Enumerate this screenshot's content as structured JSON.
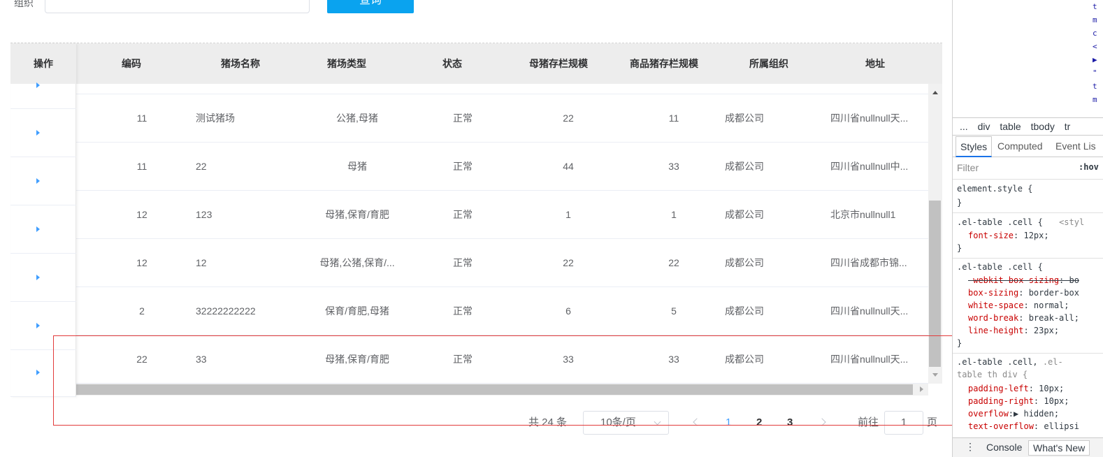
{
  "filter": {
    "label": "组织",
    "input_value": "",
    "query_label": "查询"
  },
  "table": {
    "headers": [
      "操作",
      "编码",
      "猪场名称",
      "猪场类型",
      "状态",
      "母猪存栏规模",
      "商品猪存栏规模",
      "所属组织",
      "地址"
    ],
    "rows": [
      {
        "code": "11",
        "name": "测试猪场",
        "type": "公猪,母猪",
        "status": "正常",
        "sow": "22",
        "commercial": "11",
        "org": "成都公司",
        "address": "四川省nullnull天..."
      },
      {
        "code": "11",
        "name": "22",
        "type": "母猪",
        "status": "正常",
        "sow": "44",
        "commercial": "33",
        "org": "成都公司",
        "address": "四川省nullnull中..."
      },
      {
        "code": "12",
        "name": "123",
        "type": "母猪,保育/育肥",
        "status": "正常",
        "sow": "1",
        "commercial": "1",
        "org": "成都公司",
        "address": "北京市nullnull1"
      },
      {
        "code": "12",
        "name": "12",
        "type": "母猪,公猪,保育/...",
        "status": "正常",
        "sow": "22",
        "commercial": "22",
        "org": "成都公司",
        "address": "四川省成都市锦..."
      },
      {
        "code": "2",
        "name": "32222222222",
        "type": "保育/育肥,母猪",
        "status": "正常",
        "sow": "6",
        "commercial": "5",
        "org": "成都公司",
        "address": "四川省nullnull天..."
      },
      {
        "code": "22",
        "name": "33",
        "type": "母猪,保育/育肥",
        "status": "正常",
        "sow": "33",
        "commercial": "33",
        "org": "成都公司",
        "address": "四川省nullnull天..."
      }
    ]
  },
  "pagination": {
    "total": "共 24 条",
    "page_size": "10条/页",
    "pages": [
      "1",
      "2",
      "3"
    ],
    "current": "1",
    "goto_label": "前往",
    "goto_value": "1",
    "goto_unit": "页"
  },
  "devtools": {
    "breadcrumb": [
      "...",
      "div",
      "table",
      "tbody",
      "tr"
    ],
    "tabs": [
      "Styles",
      "Computed",
      "Event Lis"
    ],
    "filter_placeholder": "Filter",
    "hov": ":hov",
    "drawer_tabs": [
      "Console",
      "What's New"
    ],
    "dom_chars": [
      "t",
      "m",
      "c",
      "<",
      "▶",
      "\"",
      "t",
      "m"
    ],
    "rules": {
      "r0_sel": "element.style {",
      "r0_close": "}",
      "r1_sel": ".el-table .cell {",
      "r1_src": "<styl",
      "r1_p1": "font-size",
      "r1_v1": ": 12px;",
      "r1_close": "}",
      "r2_sel": ".el-table .cell {",
      "r2_p1": "-webkit-box-sizing",
      "r2_v1": ": bo",
      "r2_p2": "box-sizing",
      "r2_v2": ": border-box",
      "r2_p3": "white-space",
      "r2_v3": ": normal;",
      "r2_p4": "word-break",
      "r2_v4": ": break-all;",
      "r2_p5": "line-height",
      "r2_v5": ": 23px;",
      "r2_close": "}",
      "r3_sel": ".el-table .cell,",
      "r3_sel2": ".el-",
      "r3_sel3": "table th div {",
      "r3_p1": "padding-left",
      "r3_v1": ": 10px;",
      "r3_p2": "padding-right",
      "r3_v2": ": 10px;",
      "r3_p3": "overflow",
      "r3_v3": ":▶ hidden;",
      "r3_p4": "text-overflow",
      "r3_v4": ": ellipsi"
    }
  }
}
